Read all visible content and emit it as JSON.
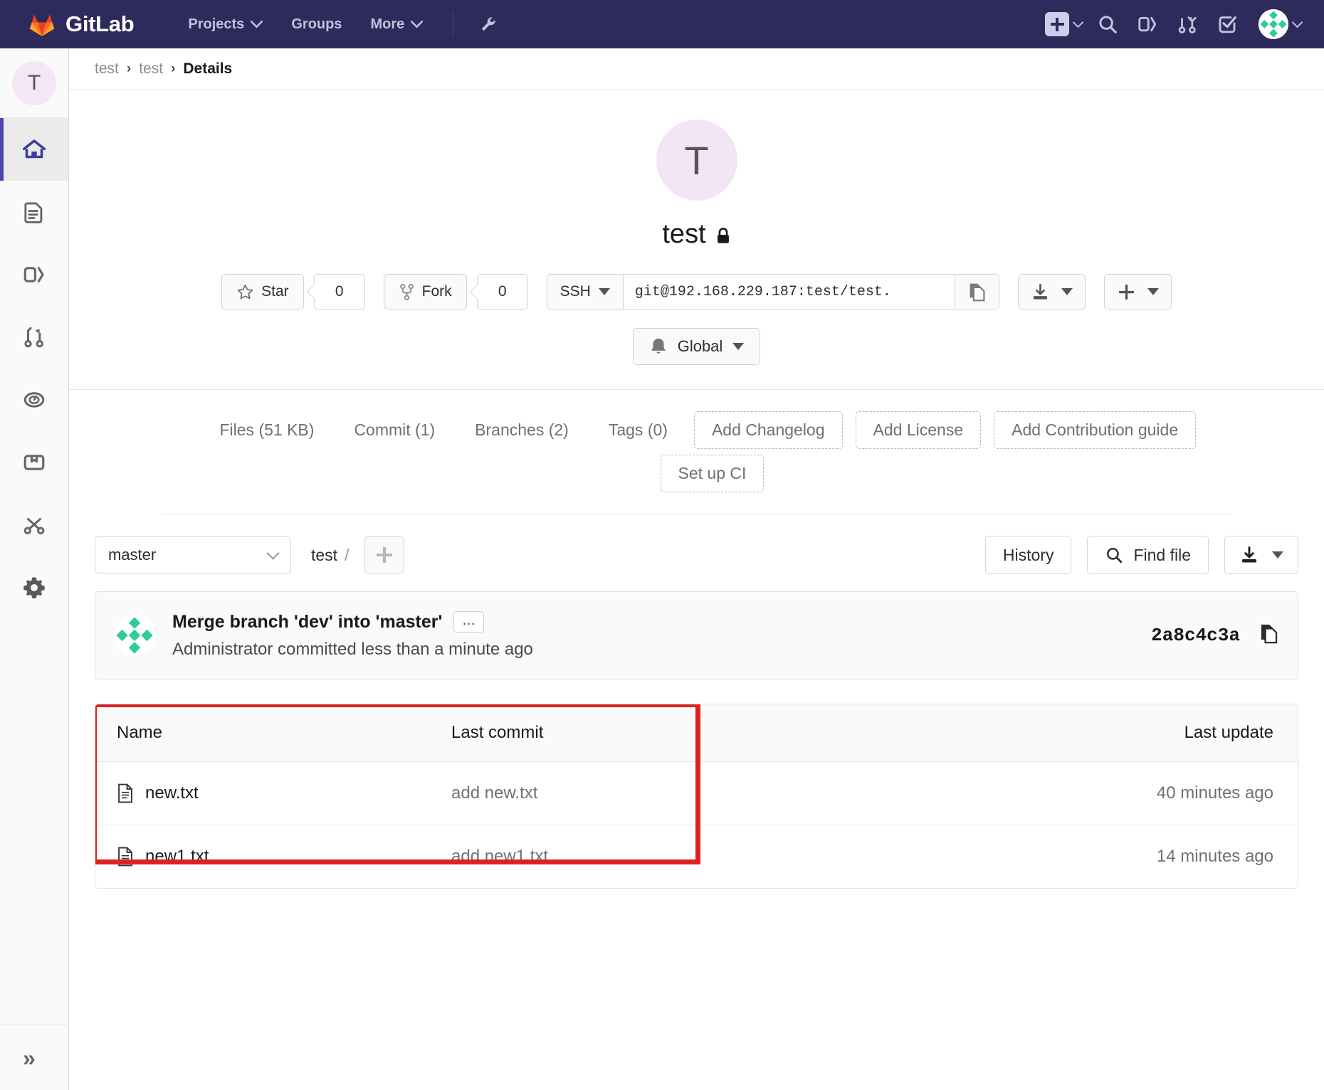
{
  "navbar": {
    "brand": "GitLab",
    "logo_icon": "gitlab-tanuki-logo",
    "links": [
      {
        "label": "Projects",
        "icon": "chevron-down-icon"
      },
      {
        "label": "Groups",
        "icon": ""
      },
      {
        "label": "More",
        "icon": "chevron-down-icon"
      }
    ],
    "wrench_icon": "wrench-icon",
    "right_icons": [
      {
        "name": "new-dropdown",
        "icon": "plus-square-icon"
      },
      {
        "name": "search",
        "icon": "search-icon"
      },
      {
        "name": "issues",
        "icon": "issues-icon"
      },
      {
        "name": "merge-requests",
        "icon": "merge-request-icon"
      },
      {
        "name": "todos",
        "icon": "todo-check-icon"
      },
      {
        "name": "user-menu",
        "icon": "avatar-identicon"
      }
    ],
    "bg_color": "#2e2a5b"
  },
  "rail": {
    "project_initial": "T",
    "items": [
      {
        "name": "project-overview",
        "icon": "home-icon",
        "active": true
      },
      {
        "name": "repository",
        "icon": "document-icon",
        "active": false
      },
      {
        "name": "issues",
        "icon": "issues-icon",
        "active": false
      },
      {
        "name": "merge-requests",
        "icon": "merge-request-icon",
        "active": false
      },
      {
        "name": "ci-cd",
        "icon": "rocket-gauge-icon",
        "active": false
      },
      {
        "name": "packages",
        "icon": "package-icon",
        "active": false
      },
      {
        "name": "snippets",
        "icon": "scissors-icon",
        "active": false
      },
      {
        "name": "settings",
        "icon": "gear-icon",
        "active": false
      }
    ],
    "collapse_icon": "double-chevron-right-icon"
  },
  "breadcrumb": {
    "items": [
      "test",
      "test"
    ],
    "current": "Details",
    "separator": "›"
  },
  "project": {
    "avatar_initial": "T",
    "name": "test",
    "visibility_icon": "lock-icon",
    "star": {
      "label": "Star",
      "icon": "star-icon",
      "count": "0"
    },
    "fork": {
      "label": "Fork",
      "icon": "fork-icon",
      "count": "0"
    },
    "clone": {
      "protocol": "SSH",
      "url": "git@192.168.229.187:test/test.",
      "copy_icon": "copy-icon"
    },
    "download_icon": "download-icon",
    "add_icon": "plus-icon",
    "notification": {
      "label": "Global",
      "icon": "bell-icon"
    }
  },
  "stats": {
    "items": [
      {
        "label": "Files (51 KB)",
        "name": "files-stat"
      },
      {
        "label": "Commit (1)",
        "name": "commits-stat"
      },
      {
        "label": "Branches (2)",
        "name": "branches-stat"
      },
      {
        "label": "Tags (0)",
        "name": "tags-stat"
      }
    ],
    "actions": [
      {
        "label": "Add Changelog",
        "name": "add-changelog"
      },
      {
        "label": "Add License",
        "name": "add-license"
      },
      {
        "label": "Add Contribution guide",
        "name": "add-contribution-guide"
      }
    ],
    "actions_line2": [
      {
        "label": "Set up CI",
        "name": "set-up-ci"
      }
    ]
  },
  "file_browser": {
    "branch": "master",
    "path_root": "test",
    "path_sep": "/",
    "history_label": "History",
    "find_file_label": "Find file",
    "find_file_icon": "search-icon",
    "download_icon": "download-icon",
    "add_to_tree_icon": "plus-icon"
  },
  "commit": {
    "title": "Merge branch 'dev' into 'master'",
    "expand_label": "...",
    "author": "Administrator",
    "meta": "Administrator committed less than a minute ago",
    "sha": "2a8c4c3a",
    "copy_icon": "copy-icon",
    "avatar_icon": "identicon-avatar"
  },
  "file_table": {
    "columns": [
      "Name",
      "Last commit",
      "Last update"
    ],
    "rows": [
      {
        "name": "new.txt",
        "icon": "file-icon",
        "last_commit": "add new.txt",
        "last_update": "40 minutes ago"
      },
      {
        "name": "new1.txt",
        "icon": "file-icon",
        "last_commit": "add new1.txt",
        "last_update": "14 minutes ago"
      }
    ]
  },
  "annotation": {
    "highlight_color": "#e02020",
    "target": "file-table-name-and-commit-columns"
  }
}
